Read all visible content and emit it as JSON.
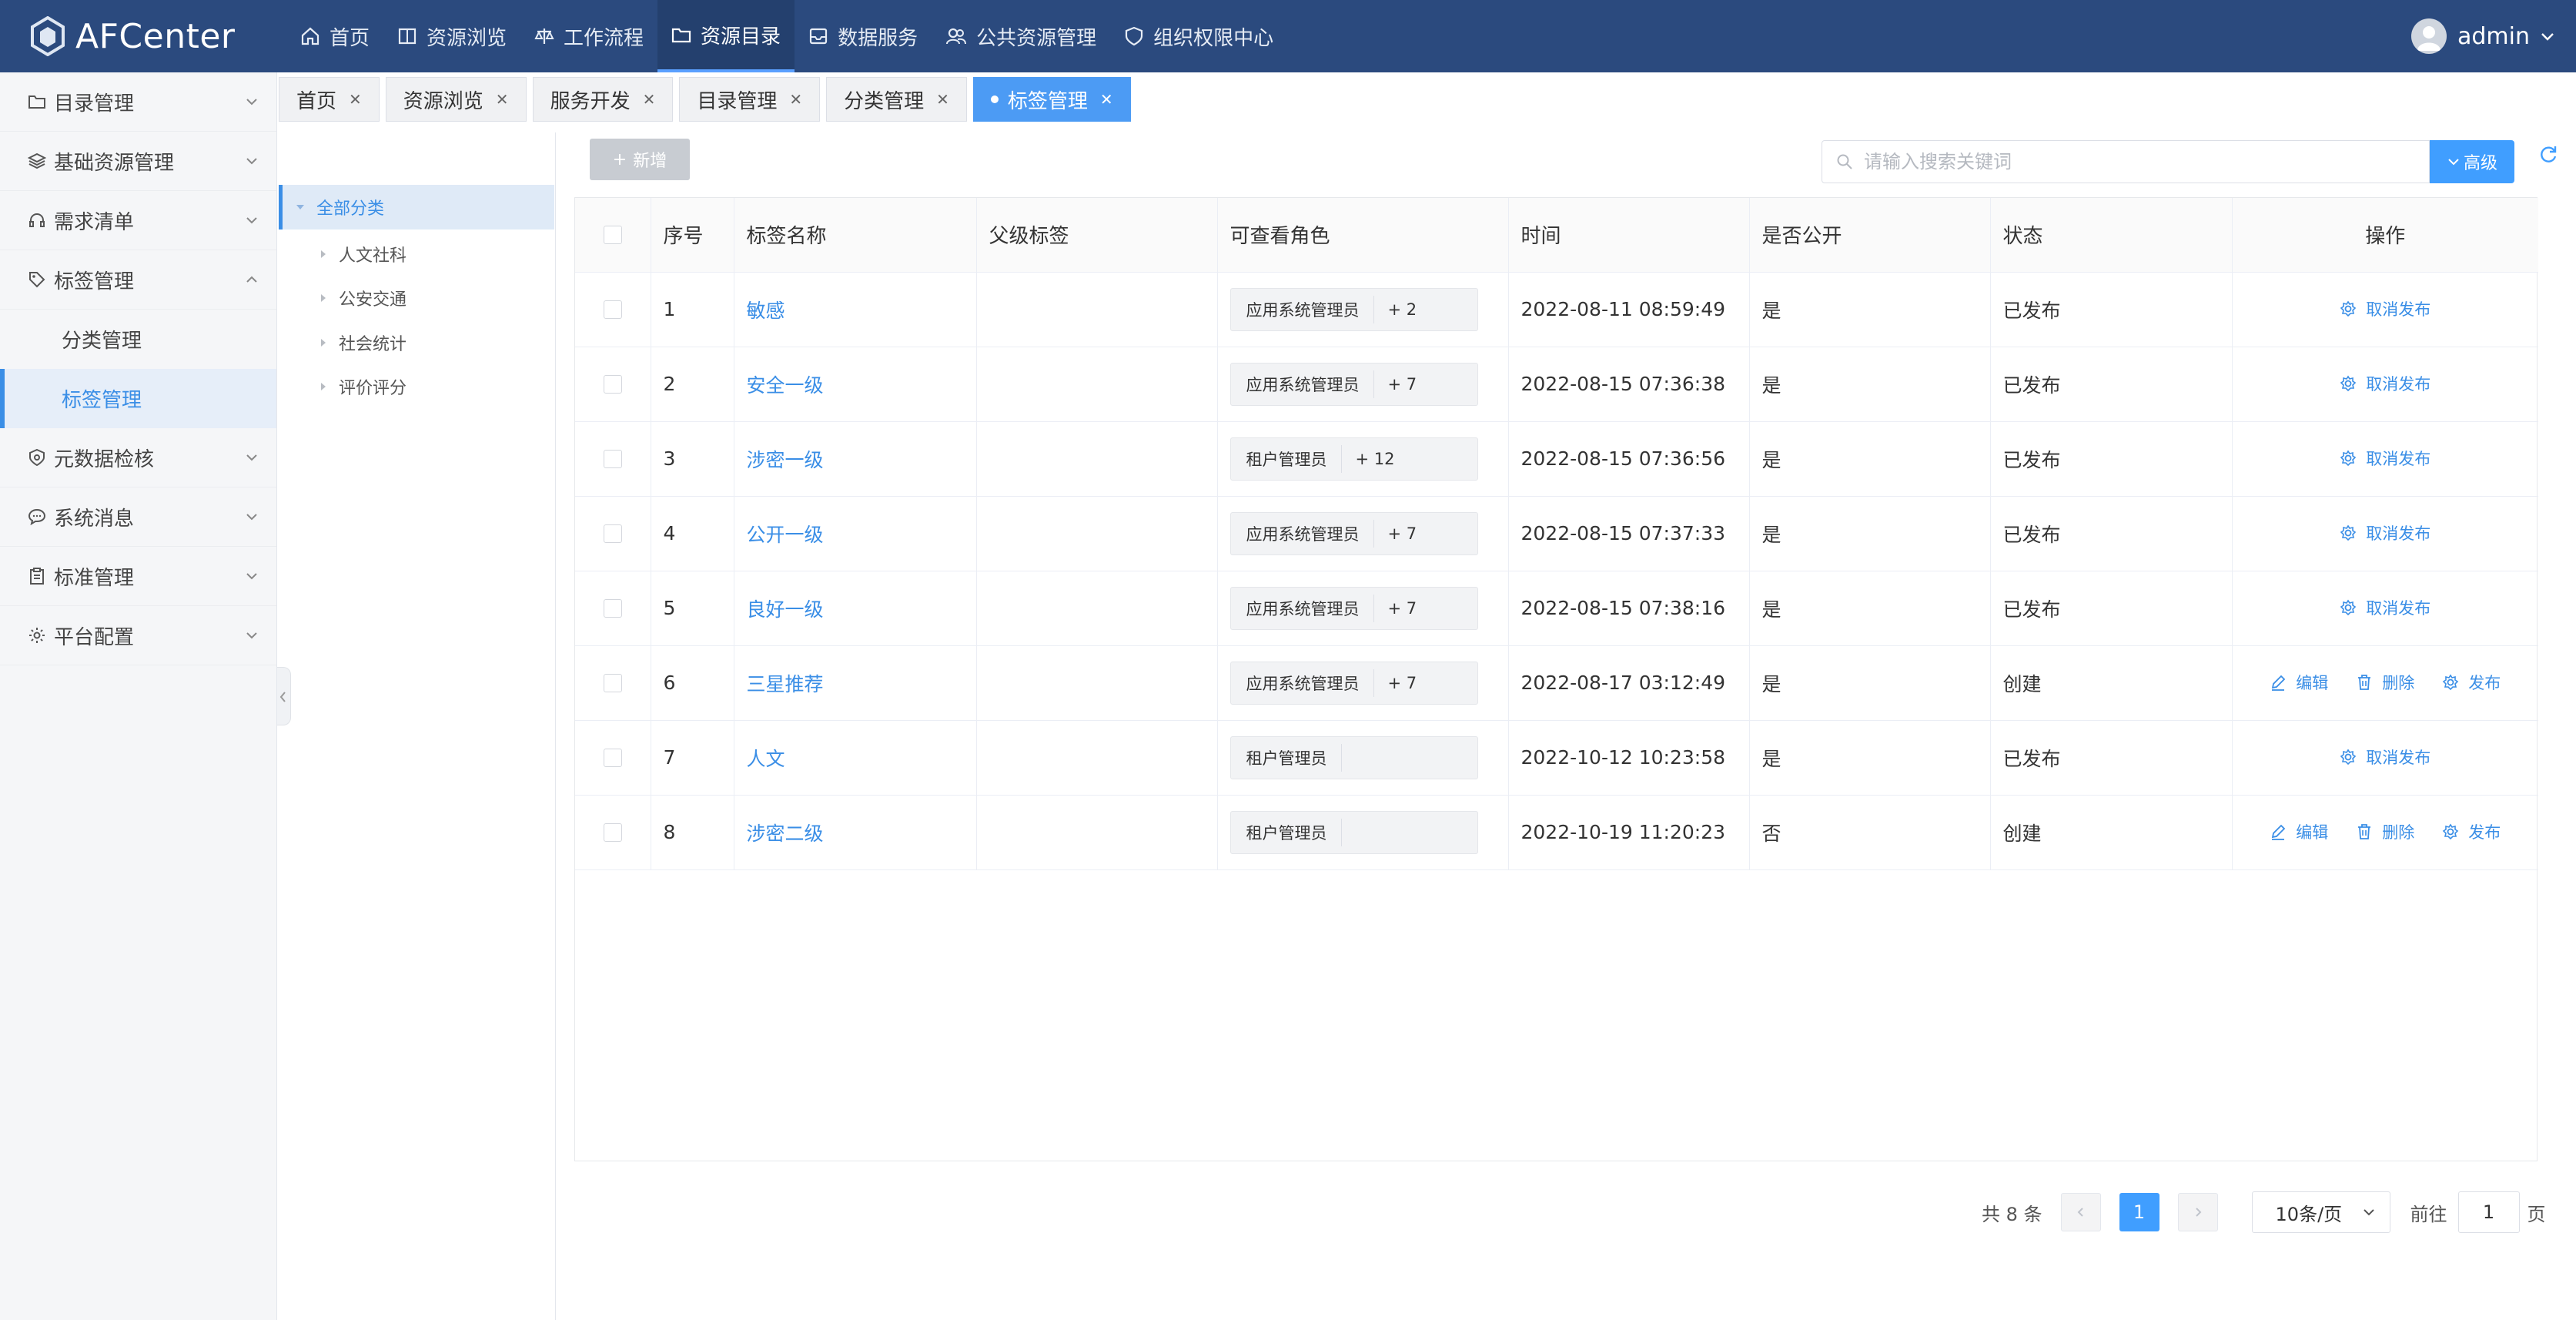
{
  "app": {
    "name": "AFCenter"
  },
  "topnav": [
    {
      "label": "首页",
      "icon": "home-icon"
    },
    {
      "label": "资源浏览",
      "icon": "book-icon"
    },
    {
      "label": "工作流程",
      "icon": "scale-icon"
    },
    {
      "label": "资源目录",
      "icon": "folder-icon",
      "active": true
    },
    {
      "label": "数据服务",
      "icon": "inbox-icon"
    },
    {
      "label": "公共资源管理",
      "icon": "users-icon"
    },
    {
      "label": "组织权限中心",
      "icon": "shield-heart-icon"
    }
  ],
  "user": {
    "name": "admin"
  },
  "sidebar": {
    "items": [
      {
        "label": "目录管理",
        "icon": "folder-icon"
      },
      {
        "label": "基础资源管理",
        "icon": "layers-icon"
      },
      {
        "label": "需求清单",
        "icon": "headset-icon"
      },
      {
        "label": "标签管理",
        "icon": "tag-icon",
        "expanded": true
      },
      {
        "label": "元数据检核",
        "icon": "shield-check-icon"
      },
      {
        "label": "系统消息",
        "icon": "chat-icon"
      },
      {
        "label": "标准管理",
        "icon": "clipboard-icon"
      },
      {
        "label": "平台配置",
        "icon": "gear-icon"
      }
    ],
    "sub_items": [
      {
        "label": "分类管理"
      },
      {
        "label": "标签管理",
        "active": true
      }
    ]
  },
  "tabs": [
    {
      "label": "首页"
    },
    {
      "label": "资源浏览"
    },
    {
      "label": "服务开发"
    },
    {
      "label": "目录管理"
    },
    {
      "label": "分类管理"
    },
    {
      "label": "标签管理",
      "active": true
    }
  ],
  "tree": {
    "root": "全部分类",
    "children": [
      "人文社科",
      "公安交通",
      "社会统计",
      "评价评分"
    ]
  },
  "toolbar": {
    "add_label": "新增",
    "search_placeholder": "请输入搜索关键词",
    "search_value": "",
    "advanced_label": "高级"
  },
  "table": {
    "columns": [
      "序号",
      "标签名称",
      "父级标签",
      "可查看角色",
      "时间",
      "是否公开",
      "状态",
      "操作"
    ],
    "rows": [
      {
        "no": "1",
        "name": "敏感",
        "parent": "",
        "role": "应用系统管理员",
        "role_more": "+ 2",
        "time": "2022-08-11 08:59:49",
        "public": "是",
        "status": "已发布",
        "actions": [
          "取消发布"
        ]
      },
      {
        "no": "2",
        "name": "安全一级",
        "parent": "",
        "role": "应用系统管理员",
        "role_more": "+ 7",
        "time": "2022-08-15 07:36:38",
        "public": "是",
        "status": "已发布",
        "actions": [
          "取消发布"
        ]
      },
      {
        "no": "3",
        "name": "涉密一级",
        "parent": "",
        "role": "租户管理员",
        "role_more": "+ 12",
        "time": "2022-08-15 07:36:56",
        "public": "是",
        "status": "已发布",
        "actions": [
          "取消发布"
        ]
      },
      {
        "no": "4",
        "name": "公开一级",
        "parent": "",
        "role": "应用系统管理员",
        "role_more": "+ 7",
        "time": "2022-08-15 07:37:33",
        "public": "是",
        "status": "已发布",
        "actions": [
          "取消发布"
        ]
      },
      {
        "no": "5",
        "name": "良好一级",
        "parent": "",
        "role": "应用系统管理员",
        "role_more": "+ 7",
        "time": "2022-08-15 07:38:16",
        "public": "是",
        "status": "已发布",
        "actions": [
          "取消发布"
        ]
      },
      {
        "no": "6",
        "name": "三星推荐",
        "parent": "",
        "role": "应用系统管理员",
        "role_more": "+ 7",
        "time": "2022-08-17 03:12:49",
        "public": "是",
        "status": "创建",
        "actions": [
          "编辑",
          "删除",
          "发布"
        ]
      },
      {
        "no": "7",
        "name": "人文",
        "parent": "",
        "role": "租户管理员",
        "role_more": "",
        "time": "2022-10-12 10:23:58",
        "public": "是",
        "status": "已发布",
        "actions": [
          "取消发布"
        ]
      },
      {
        "no": "8",
        "name": "涉密二级",
        "parent": "",
        "role": "租户管理员",
        "role_more": "",
        "time": "2022-10-19 11:20:23",
        "public": "否",
        "status": "创建",
        "actions": [
          "编辑",
          "删除",
          "发布"
        ]
      }
    ]
  },
  "pagination": {
    "total_text": "共 8 条",
    "current_page": "1",
    "page_size": "10条/页",
    "goto_label": "前往",
    "goto_value": "1",
    "page_suffix": "页"
  },
  "colors": {
    "header_bg": "#2b4a7e",
    "accent": "#409eff",
    "link": "#3a8ee6"
  }
}
